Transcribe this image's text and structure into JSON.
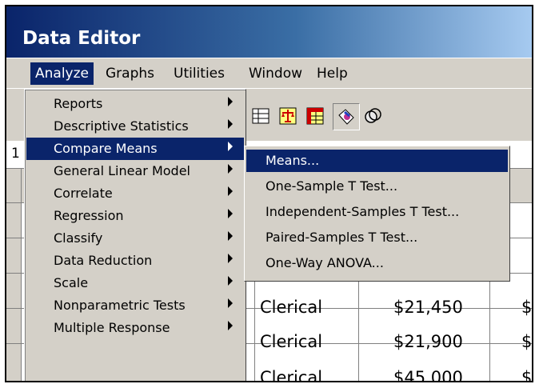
{
  "window": {
    "title": "Data Editor"
  },
  "menubar": {
    "items": [
      {
        "label": "Analyze",
        "active": true
      },
      {
        "label": "Graphs"
      },
      {
        "label": "Utilities"
      },
      {
        "label": "Window"
      },
      {
        "label": "Help"
      }
    ]
  },
  "toolbar": {
    "icons": [
      "grid-chart-icon",
      "scale-icon",
      "table-icon",
      "pointer-tag-icon",
      "circles-icon"
    ]
  },
  "cellbar": {
    "id": "1"
  },
  "analyze_menu": {
    "items": [
      {
        "label": "Reports",
        "submenu": true
      },
      {
        "label": "Descriptive Statistics",
        "submenu": true
      },
      {
        "label": "Compare Means",
        "submenu": true,
        "highlighted": true
      },
      {
        "label": "General Linear Model",
        "submenu": true
      },
      {
        "label": "Correlate",
        "submenu": true
      },
      {
        "label": "Regression",
        "submenu": true
      },
      {
        "label": "Classify",
        "submenu": true
      },
      {
        "label": "Data Reduction",
        "submenu": true
      },
      {
        "label": "Scale",
        "submenu": true
      },
      {
        "label": "Nonparametric Tests",
        "submenu": true
      },
      {
        "label": "Multiple Response",
        "submenu": true
      }
    ]
  },
  "compare_means_submenu": {
    "items": [
      {
        "label": "Means...",
        "highlighted": true
      },
      {
        "label": "One-Sample T Test..."
      },
      {
        "label": "Independent-Samples T Test..."
      },
      {
        "label": "Paired-Samples T Test..."
      },
      {
        "label": "One-Way ANOVA..."
      }
    ]
  },
  "grid": {
    "rows": [
      {
        "jobcat": "Clerical",
        "salary": "$21,450",
        "next": "$"
      },
      {
        "jobcat": "Clerical",
        "salary": "$21,900",
        "next": "$"
      },
      {
        "jobcat": "Clerical",
        "salary": "$45,000",
        "next": "$"
      }
    ]
  },
  "colors": {
    "highlight": "#0a246a",
    "menu_bg": "#d4d0c8",
    "title_start": "#0a246a",
    "title_end": "#a6caf0"
  }
}
